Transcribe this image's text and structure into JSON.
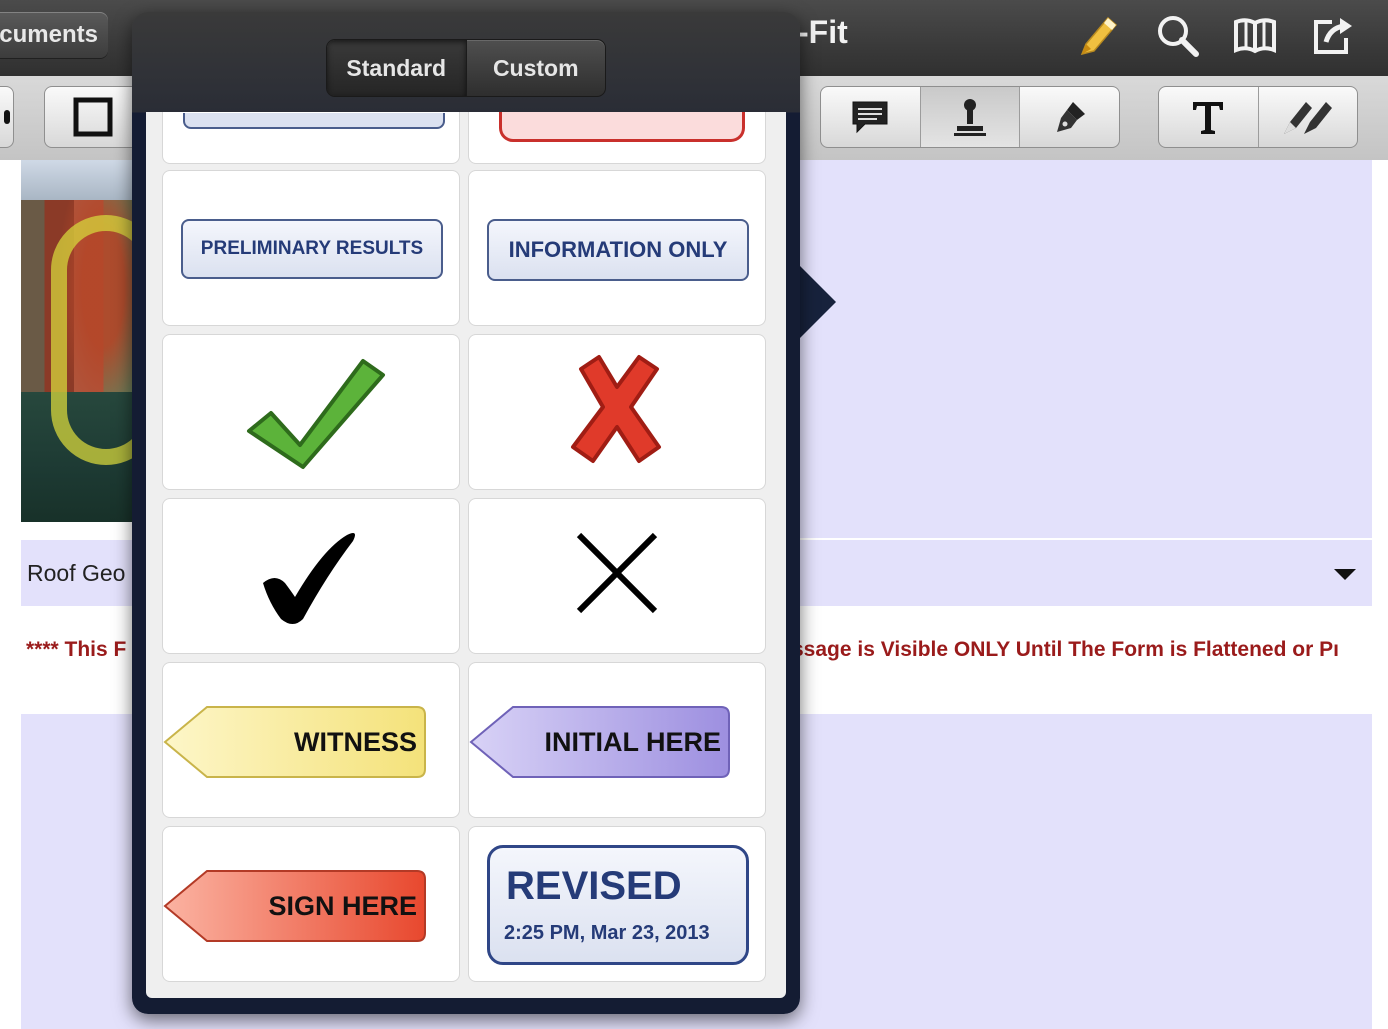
{
  "titlebar": {
    "documents_label": "cuments",
    "title": "-Fit",
    "icons": [
      "highlighter-icon",
      "search-icon",
      "book-icon",
      "share-icon"
    ]
  },
  "toolbar": {
    "tools": [
      "square-shape-icon",
      "comment-icon",
      "stamp-icon",
      "pen-nib-icon",
      "text-icon",
      "signature-pen-icon"
    ]
  },
  "document": {
    "field_label": "Roof Geo",
    "notice_left": "**** This F",
    "notice_right": "ssage is Visible ONLY Until The Form is Flattened or Pı"
  },
  "popover": {
    "tabs": [
      {
        "label": "Standard",
        "active": true
      },
      {
        "label": "Custom",
        "active": false
      }
    ],
    "stamps": {
      "preliminary": "PRELIMINARY RESULTS",
      "information": "INFORMATION ONLY",
      "witness": "WITNESS",
      "initial_here": "INITIAL HERE",
      "sign_here": "SIGN HERE",
      "revised": "REVISED",
      "revised_date": "2:25 PM, Mar 23, 2013"
    }
  },
  "colors": {
    "page_lavender": "#e3e1fb",
    "notice_red": "#9a1b1b",
    "stamp_blue": "#253b78",
    "check_green": "#4a9a2e",
    "x_red": "#e03a2a"
  }
}
